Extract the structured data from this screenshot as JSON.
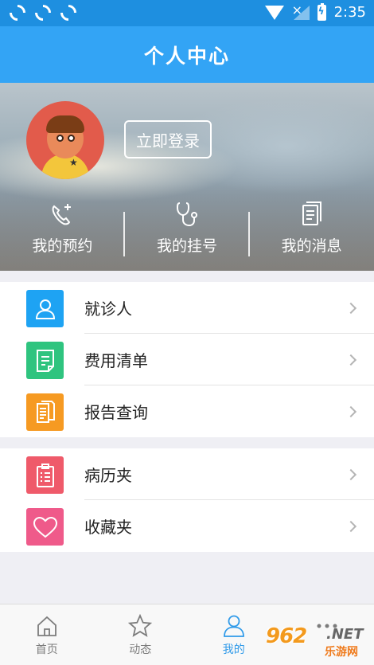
{
  "status_bar": {
    "time": "2:35",
    "left_icons": [
      "sync-icon",
      "sync-icon",
      "sync-icon"
    ],
    "right_icons": [
      "wifi-icon",
      "no-signal-icon",
      "battery-charging-icon"
    ]
  },
  "header": {
    "title": "个人中心",
    "background_color": "#33a4f5"
  },
  "profile": {
    "login_button": "立即登录",
    "avatar_icon": "child-avatar-icon"
  },
  "quick_actions": [
    {
      "label": "我的预约",
      "icon": "phone-plus-icon"
    },
    {
      "label": "我的挂号",
      "icon": "stethoscope-icon"
    },
    {
      "label": "我的消息",
      "icon": "document-icon"
    }
  ],
  "menu_group_1": [
    {
      "label": "就诊人",
      "icon": "person-icon",
      "color": "#1ea3f3"
    },
    {
      "label": "费用清单",
      "icon": "bill-icon",
      "color": "#2fc47f"
    },
    {
      "label": "报告查询",
      "icon": "report-icon",
      "color": "#f69a22"
    }
  ],
  "menu_group_2": [
    {
      "label": "病历夹",
      "icon": "clipboard-icon",
      "color": "#ef5a6a"
    },
    {
      "label": "收藏夹",
      "icon": "heart-icon",
      "color": "#ef5a8a"
    }
  ],
  "tabs": [
    {
      "label": "首页",
      "icon": "home-icon",
      "active": false
    },
    {
      "label": "动态",
      "icon": "star-icon",
      "active": false
    },
    {
      "label": "我的",
      "icon": "user-icon",
      "active": true
    },
    {
      "label": "",
      "icon": "more-icon",
      "active": false
    }
  ],
  "watermark": {
    "number": "962",
    "domain": ".NET",
    "text": "乐游网"
  }
}
